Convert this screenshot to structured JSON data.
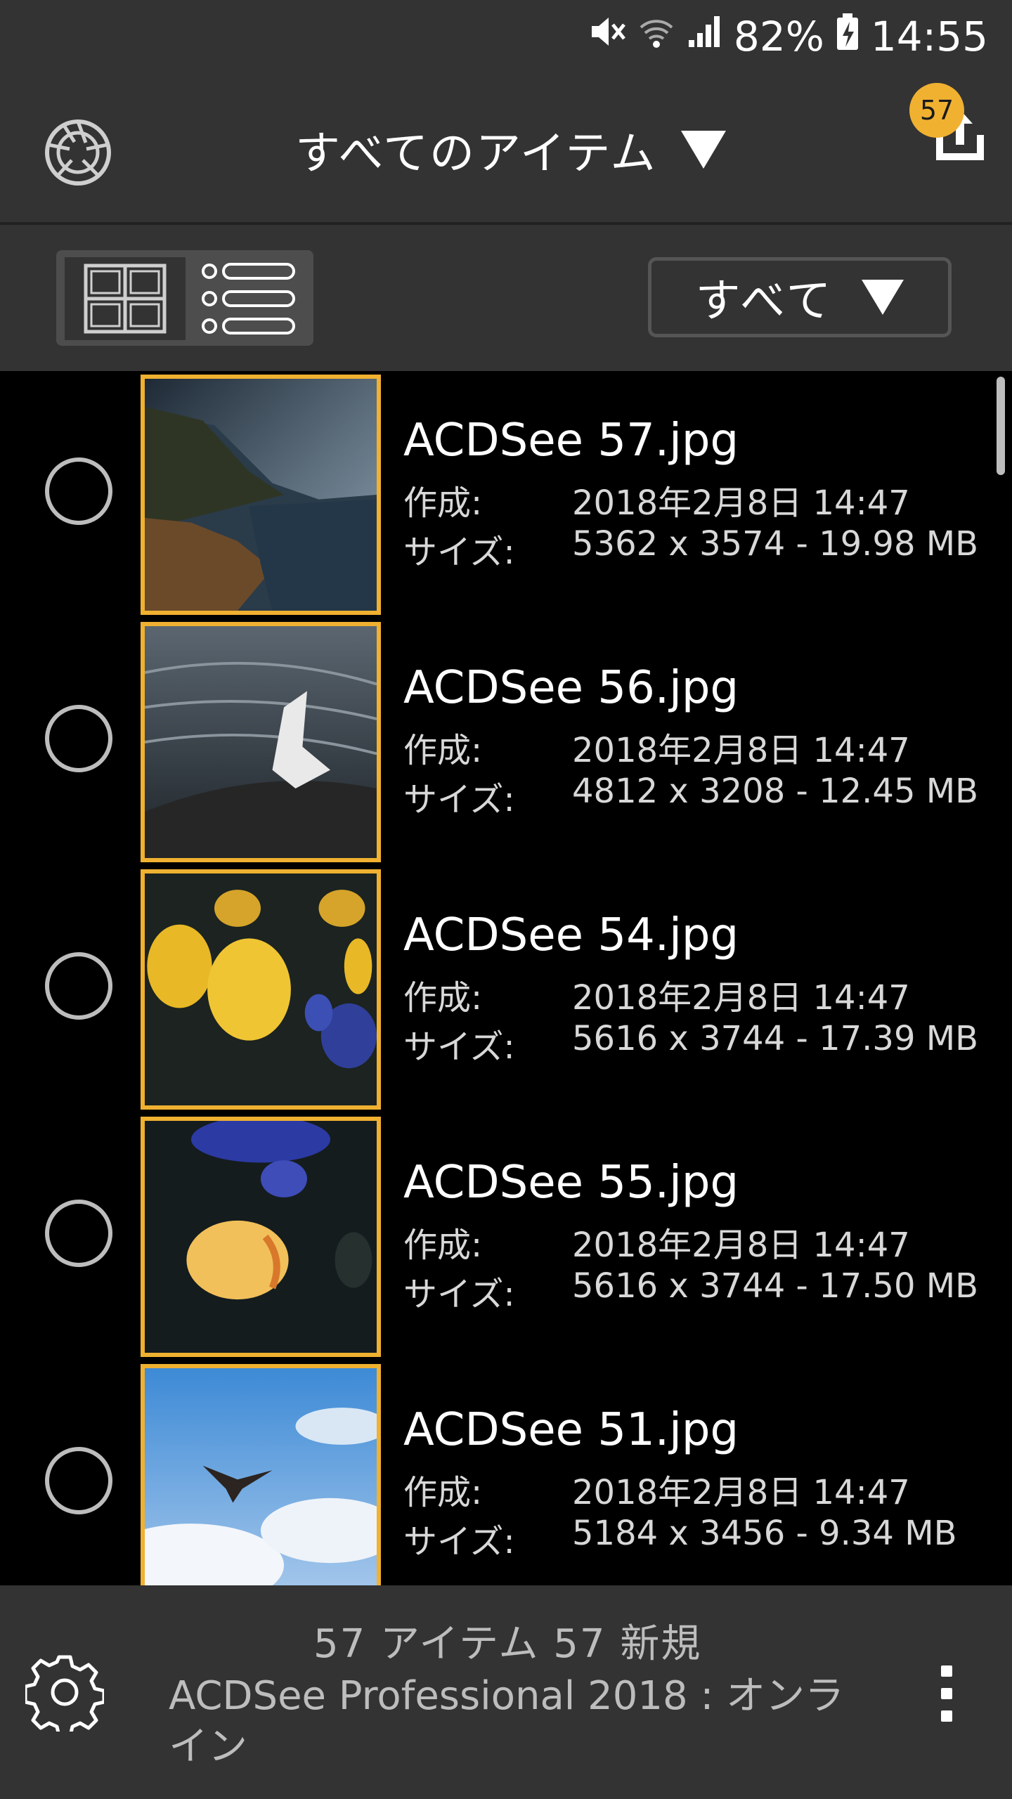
{
  "status_bar": {
    "battery": "82%",
    "time": "14:55",
    "icons": [
      "mute-icon",
      "wifi-icon",
      "signal-icon",
      "battery-charging-icon"
    ]
  },
  "app_bar": {
    "title": "すべてのアイテム",
    "upload_badge": "57"
  },
  "toolbar": {
    "filter_label": "すべて"
  },
  "files": [
    {
      "name": "ACDSee 57.jpg",
      "created_label": "作成:",
      "created": "2018年2月8日 14:47",
      "size_label": "サイズ:",
      "size": "5362 x 3574 - 19.98 MB"
    },
    {
      "name": "ACDSee 56.jpg",
      "created_label": "作成:",
      "created": "2018年2月8日 14:47",
      "size_label": "サイズ:",
      "size": "4812 x 3208 - 12.45 MB"
    },
    {
      "name": "ACDSee 54.jpg",
      "created_label": "作成:",
      "created": "2018年2月8日 14:47",
      "size_label": "サイズ:",
      "size": "5616 x 3744 - 17.39 MB"
    },
    {
      "name": "ACDSee 55.jpg",
      "created_label": "作成:",
      "created": "2018年2月8日 14:47",
      "size_label": "サイズ:",
      "size": "5616 x 3744 - 17.50 MB"
    },
    {
      "name": "ACDSee 51.jpg",
      "created_label": "作成:",
      "created": "2018年2月8日 14:47",
      "size_label": "サイズ:",
      "size": "5184 x 3456 - 9.34 MB"
    }
  ],
  "bottom_bar": {
    "counts": "57 アイテム  57 新規",
    "server": "ACDSee Professional 2018 : オンライン"
  },
  "colors": {
    "accent": "#f0b131",
    "bar": "#333333",
    "background": "#000000"
  }
}
